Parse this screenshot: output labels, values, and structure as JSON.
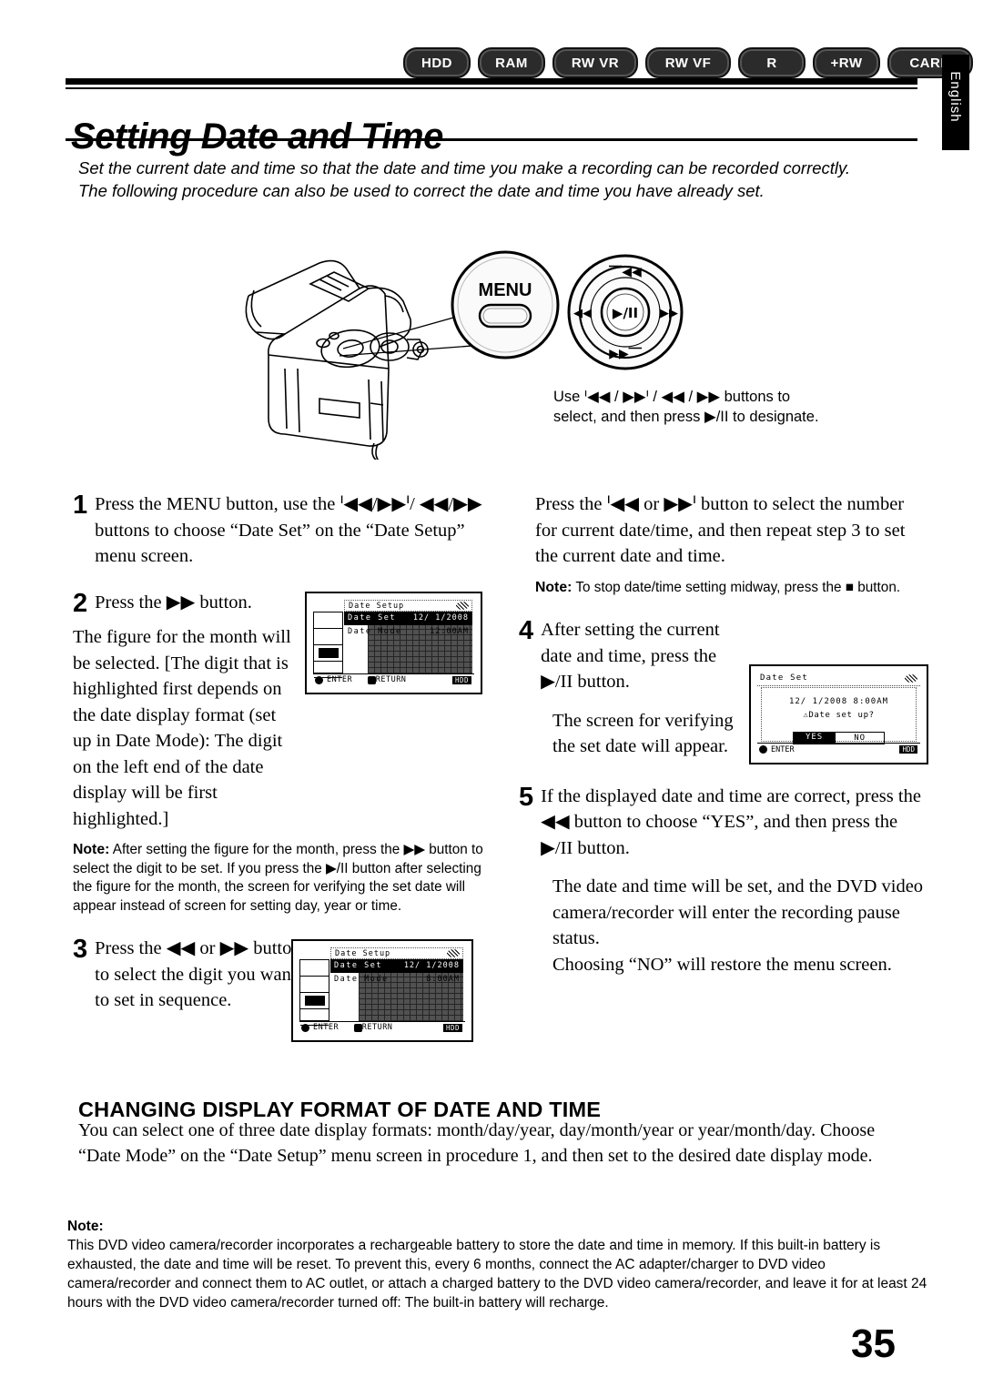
{
  "header": {
    "badges": [
      {
        "label": "HDD"
      },
      {
        "label": "RAM"
      },
      {
        "label": "RW VR"
      },
      {
        "label": "RW VF"
      },
      {
        "label": "R"
      },
      {
        "label": "+RW"
      },
      {
        "label": "CARD"
      }
    ],
    "side_tab": "English"
  },
  "title": "Setting Date and Time",
  "intro": "Set the current date and time so that the date and time you make a recording can be recorded correctly.\nThe following procedure can also be used to correct the date and time you have already set.",
  "illustration": {
    "menu_label": "MENU",
    "joystick": {
      "up": "ᑊ◀◀",
      "down": "▶▶ᑊ",
      "left": "◀◀",
      "right": "▶▶",
      "center": "▶/II"
    },
    "caption": "Use ᑊ◀◀ / ▶▶ᑊ / ◀◀ / ▶▶ buttons to select, and then press ▶/II to designate."
  },
  "steps": {
    "s1_num": "1",
    "s1_text": "Press the MENU button, use the ᑊ◀◀/▶▶ᑊ/ ◀◀/▶▶ buttons to choose “Date Set” on the “Date Setup” menu screen.",
    "s2_num": "2",
    "s2_text": "Press the ▶▶ button.",
    "s2_body": "The figure for the month will be selected. [The digit that is highlighted first depends on the date display format (set up in Date Mode): The digit on the left end of the date display will be first highlighted.]",
    "s2_note_title": "Note:",
    "s2_note": "After setting the figure for the month, press the ▶▶ button to select the digit to be set. If you press the ▶/II button after selecting the figure for the month, the screen for verifying the set date will appear instead of screen for setting day, year or time.",
    "s3_num": "3",
    "s3_text": "Press the ◀◀ or ▶▶ button to select the digit you want to set in sequence.",
    "r_intro": "Press the ᑊ◀◀ or ▶▶ᑊ button to select the number for current date/time, and then repeat step 3 to set the current date and time.",
    "r_note_title": "Note:",
    "r_note": "To stop date/time setting midway, press the ■ button.",
    "s4_num": "4",
    "s4_text": "After setting the current date and time, press the ▶/II button.",
    "s4_body": "The screen for verifying the set date will appear.",
    "s5_num": "5",
    "s5_text": "If the displayed date and time are correct, press the ◀◀ button to choose “YES”, and then press the ▶/II button.",
    "s5_body": "The date and time will be set, and the DVD video camera/recorder will enter the recording pause status.\nChoosing “NO” will restore the menu screen."
  },
  "lcd_step2": {
    "title": "Date Setup",
    "row1_label": "Date Set",
    "row1_value": "12/ 1/2008",
    "row2_label": "Date Mode",
    "row2_value": "12:00AM",
    "footer_enter": "ENTER",
    "footer_return": "RETURN",
    "footer_badge": "HDD"
  },
  "lcd_step3": {
    "title": "Date Setup",
    "row1_label": "Date Set",
    "row1_value": "12/ 1/2008",
    "row2_label": "Date Mode",
    "row2_value": "8:00AM",
    "footer_enter": "ENTER",
    "footer_return": "RETURN",
    "footer_badge": "HDD"
  },
  "lcd_step4": {
    "title": "Date Set",
    "datetime": "12/ 1/2008 8:00AM",
    "question": "⚠Date set up?",
    "yes": "YES",
    "no": "NO",
    "footer_enter": "ENTER",
    "footer_badge": "HDD"
  },
  "subsection": {
    "heading": "CHANGING DISPLAY FORMAT OF DATE AND TIME",
    "body": "You can select one of three date display formats: month/day/year, day/month/year or year/month/day. Choose “Date Mode” on the “Date Setup” menu screen in procedure 1, and then set to the desired date display mode."
  },
  "bottom_note": {
    "title": "Note:",
    "body": "This DVD video camera/recorder incorporates a rechargeable battery to store the date and time in memory. If this built-in battery is exhausted, the date and time will be reset. To prevent this, every 6 months, connect the AC adapter/charger to DVD video camera/recorder and connect them to AC outlet, or attach a charged battery to the DVD video camera/recorder, and leave it for at least 24 hours with the DVD video camera/recorder turned off: The built-in battery will recharge."
  },
  "page_number": "35"
}
